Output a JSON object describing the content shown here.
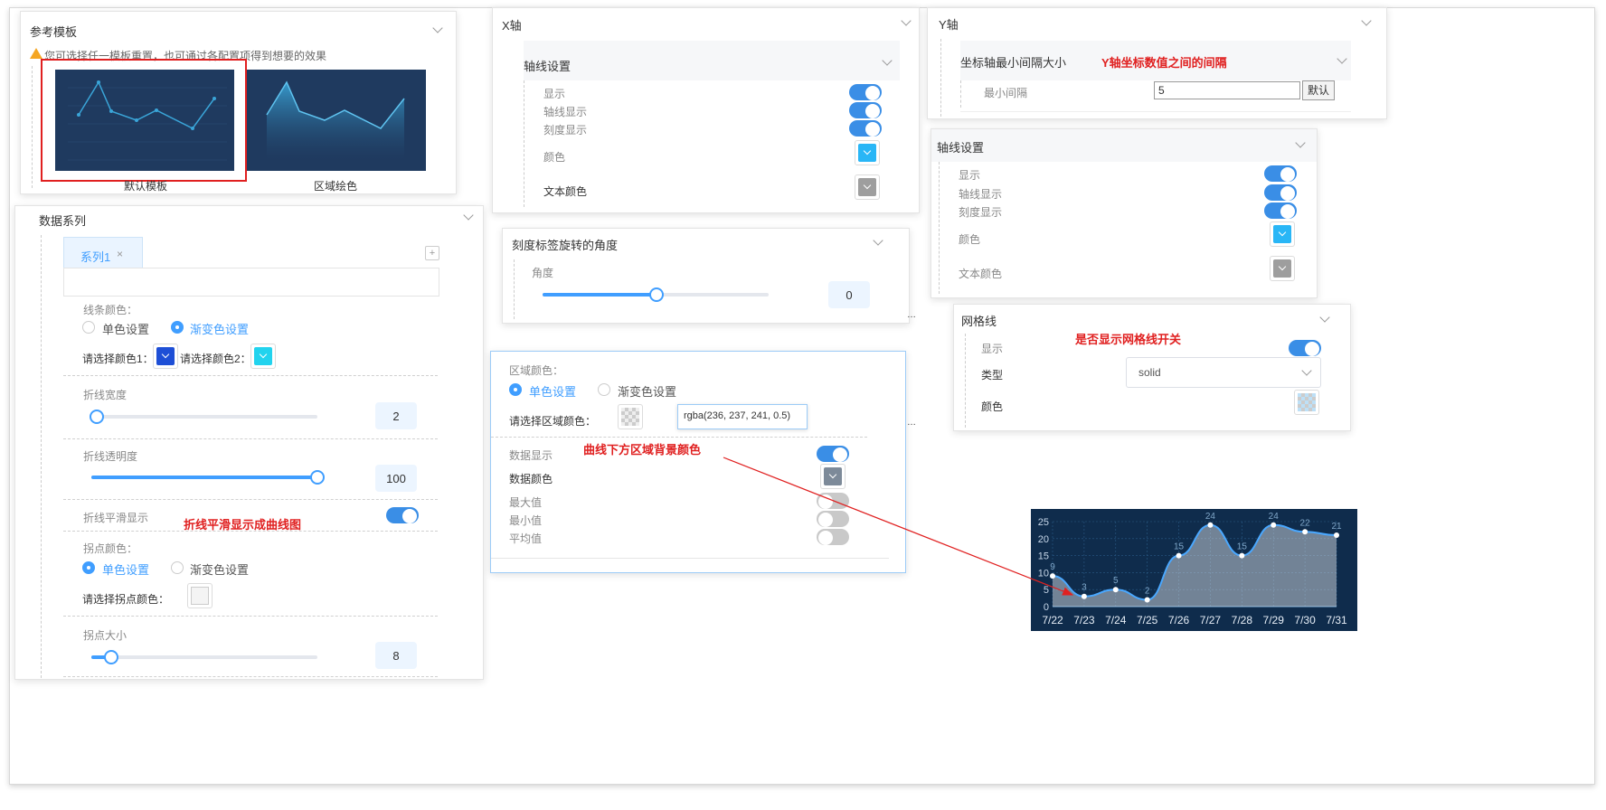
{
  "template_panel": {
    "title": "参考模板",
    "warning": "您可选择任一模板重置，也可通过各配置项得到想要的效果",
    "templates": [
      {
        "label": "默认模板"
      },
      {
        "label": "区域绘色"
      }
    ]
  },
  "series_panel": {
    "title": "数据系列",
    "tab_label": "系列1",
    "tab_close": "×",
    "add_icon": "+",
    "line_color": {
      "label": "线条颜色：",
      "option_single": "单色设置",
      "option_gradient": "渐变色设置",
      "selected": "渐变色设置",
      "color1_label": "请选择颜色1：",
      "color2_label": "请选择颜色2：",
      "color1": "#1e4fd6",
      "color2": "#22d3ee"
    },
    "line_width": {
      "label": "折线宽度",
      "value": "2",
      "fraction": 0.02
    },
    "line_opacity": {
      "label": "折线透明度",
      "value": "100",
      "fraction": 1.0
    },
    "smooth": {
      "label": "折线平滑显示",
      "on": true
    },
    "point_color": {
      "label": "拐点颜色：",
      "option_single": "单色设置",
      "option_gradient": "渐变色设置",
      "selected": "单色设置",
      "picker_label": "请选择拐点颜色："
    },
    "point_size": {
      "label": "拐点大小",
      "value": "8",
      "fraction": 0.08
    }
  },
  "x_axis_panel": {
    "title": "X轴",
    "axis_section": "轴线设置",
    "items": [
      {
        "label": "显示",
        "on": true
      },
      {
        "label": "轴线显示",
        "on": true
      },
      {
        "label": "刻度显示",
        "on": true
      }
    ],
    "color_label": "颜色",
    "color": "#29b6f6",
    "text_color_label": "文本颜色",
    "text_color": "#9e9e9e"
  },
  "rotate_panel": {
    "title": "刻度标签旋转的角度",
    "angle_label": "角度",
    "value": "0",
    "fraction": 0.5
  },
  "area_panel": {
    "title": "区域颜色：",
    "option_single": "单色设置",
    "option_gradient": "渐变色设置",
    "selected": "单色设置",
    "picker_label": "请选择区域颜色：",
    "rgba_value": "rgba(236, 237, 241, 0.5)",
    "data_show_label": "数据显示",
    "data_show_on": true,
    "data_color_label": "数据颜色",
    "data_color": "#7d8a99",
    "max_label": "最大值",
    "min_label": "最小值",
    "avg_label": "平均值"
  },
  "y_axis_panel": {
    "title": "Y轴",
    "interval_label": "坐标轴最小间隔大小",
    "min_interval_label": "最小间隔",
    "min_interval_value": "5",
    "default_button": "默认"
  },
  "y_axis_line_panel": {
    "title": "轴线设置",
    "items": [
      {
        "label": "显示",
        "on": true
      },
      {
        "label": "轴线显示",
        "on": true
      },
      {
        "label": "刻度显示",
        "on": true
      }
    ],
    "color_label": "颜色",
    "color": "#29b6f6",
    "text_color_label": "文本颜色",
    "text_color": "#9e9e9e"
  },
  "grid_panel": {
    "title": "网格线",
    "show_label": "显示",
    "type_label": "类型",
    "type_value": "solid",
    "color_label": "颜色"
  },
  "annotations": {
    "y_interval": "Y轴坐标数值之间的间隔",
    "grid_switch": "是否显示网格线开关",
    "smooth": "折线平滑显示成曲线图",
    "area_bg": "曲线下方区域背景颜色"
  },
  "chart_data": {
    "type": "area",
    "categories": [
      "7/22",
      "7/23",
      "7/24",
      "7/25",
      "7/26",
      "7/27",
      "7/28",
      "7/29",
      "7/30",
      "7/31"
    ],
    "values": [
      9,
      3,
      5,
      2,
      15,
      24,
      15,
      24,
      22,
      21
    ],
    "ylim": [
      0,
      25
    ],
    "yticks": [
      "0",
      "5",
      "10",
      "15",
      "20",
      "25"
    ],
    "background": "#0f2c4c",
    "line_color": "#4aa8ff",
    "grid": true
  }
}
